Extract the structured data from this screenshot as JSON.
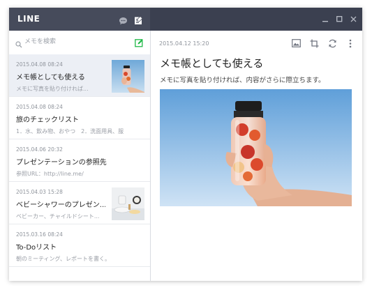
{
  "app": {
    "title": "LINE"
  },
  "search": {
    "placeholder": "メモを検索"
  },
  "notes": [
    {
      "date": "2015.04.08  08:24",
      "title": "メモ帳としても使える",
      "preview": "メモに写真を貼り付ければ...",
      "selected": true,
      "thumbnail": "water-bottle-photo"
    },
    {
      "date": "2015.04.08  08:24",
      "title": "旅のチェックリスト",
      "preview": "1．水、飲み物、おやつ　2．洗面用具、服"
    },
    {
      "date": "2015.04.06  20:32",
      "title": "プレゼンテーションの参照先",
      "preview": "参照URL：http://line.me/"
    },
    {
      "date": "2015.04.03  15:28",
      "title": "ベビーシャワーのプレゼン...",
      "preview": "ベビーカー、チャイルドシート...",
      "thumbnail": "baby-items-photo"
    },
    {
      "date": "2015.03.16  08:24",
      "title": "To-Doリスト",
      "preview": "朝のミーティング、レポートを書く。"
    }
  ],
  "content": {
    "date": "2015.04.12  15:20",
    "title": "メモ帳としても使える",
    "body": "メモに写真を貼り付ければ、内容がさらに際立ちます。",
    "image": "water-bottle-photo"
  },
  "colors": {
    "titlebar": "#3b4050",
    "titlebar_left": "#464b5b",
    "accent_green": "#1fb846",
    "selected_bg": "#eceff5"
  }
}
